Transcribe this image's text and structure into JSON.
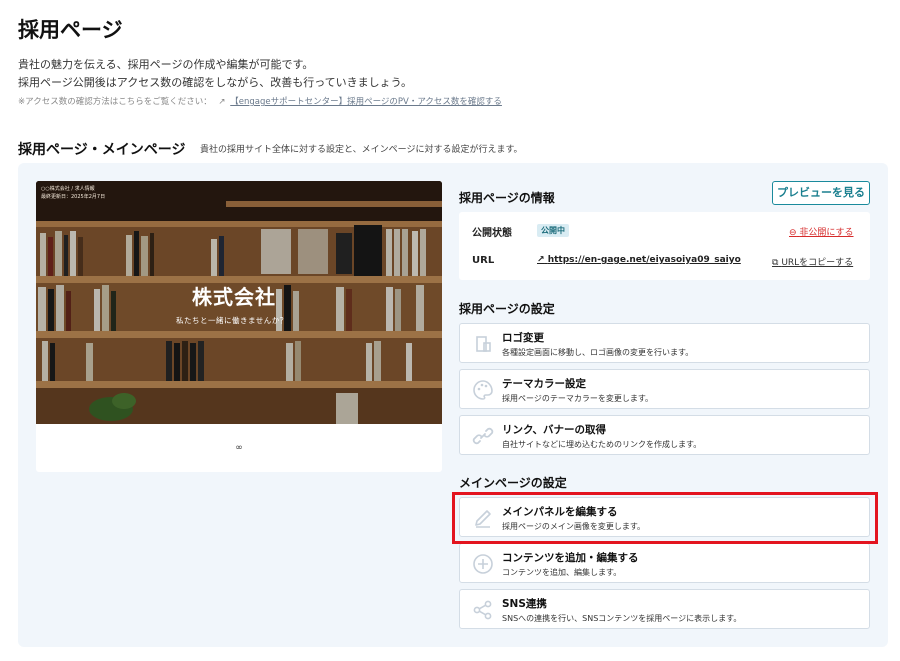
{
  "page": {
    "title": "採用ページ",
    "desc1": "貴社の魅力を伝える、採用ページの作成や編集が可能です。",
    "desc2": "採用ページ公開後はアクセス数の確認をしながら、改善も行っていきましょう。",
    "note_prefix": "※アクセス数の確認方法はこちらをご覧ください：",
    "note_link": "【engageサポートセンター】採用ページのPV・アクセス数を確認する"
  },
  "section": {
    "title": "採用ページ・メインページ",
    "subtitle": "貴社の採用サイト全体に対する設定と、メインページに対する設定が行えます。"
  },
  "preview": {
    "meta_line1": "○○株式会社 / 求人情報",
    "meta_line2": "最終更新日：2025年2月7日",
    "company": "株式会社",
    "catchcopy": "私たちと一緒に働きませんか？",
    "footer": "∞"
  },
  "info": {
    "title": "採用ページの情報",
    "preview_button": "プレビューを見る",
    "status_label": "公開状態",
    "status_badge": "公開中",
    "unpublish": "非公開にする",
    "url_label": "URL",
    "url": "https://en-gage.net/eiyasoiya09_saiyo",
    "copy": "URLをコピーする"
  },
  "settings": {
    "title": "採用ページの設定",
    "items": [
      {
        "title": "ロゴ変更",
        "desc": "各種設定画面に移動し、ロゴ画像の変更を行います。",
        "icon": "logo-icon"
      },
      {
        "title": "テーマカラー設定",
        "desc": "採用ページのテーマカラーを変更します。",
        "icon": "palette-icon"
      },
      {
        "title": "リンク、バナーの取得",
        "desc": "自社サイトなどに埋め込むためのリンクを作成します。",
        "icon": "link-icon"
      }
    ]
  },
  "main_settings": {
    "title": "メインページの設定",
    "items": [
      {
        "title": "メインパネルを編集する",
        "desc": "採用ページのメイン画像を変更します。",
        "icon": "pencil-icon"
      },
      {
        "title": "コンテンツを追加・編集する",
        "desc": "コンテンツを追加、編集します。",
        "icon": "plus-circle-icon"
      },
      {
        "title": "SNS連携",
        "desc": "SNSへの連携を行い、SNSコンテンツを採用ページに表示します。",
        "icon": "share-icon"
      }
    ]
  },
  "colors": {
    "accent": "#1a8a9c",
    "danger": "#d62b2b",
    "highlight": "#e3141f",
    "panel_bg": "#f1f6fb"
  }
}
